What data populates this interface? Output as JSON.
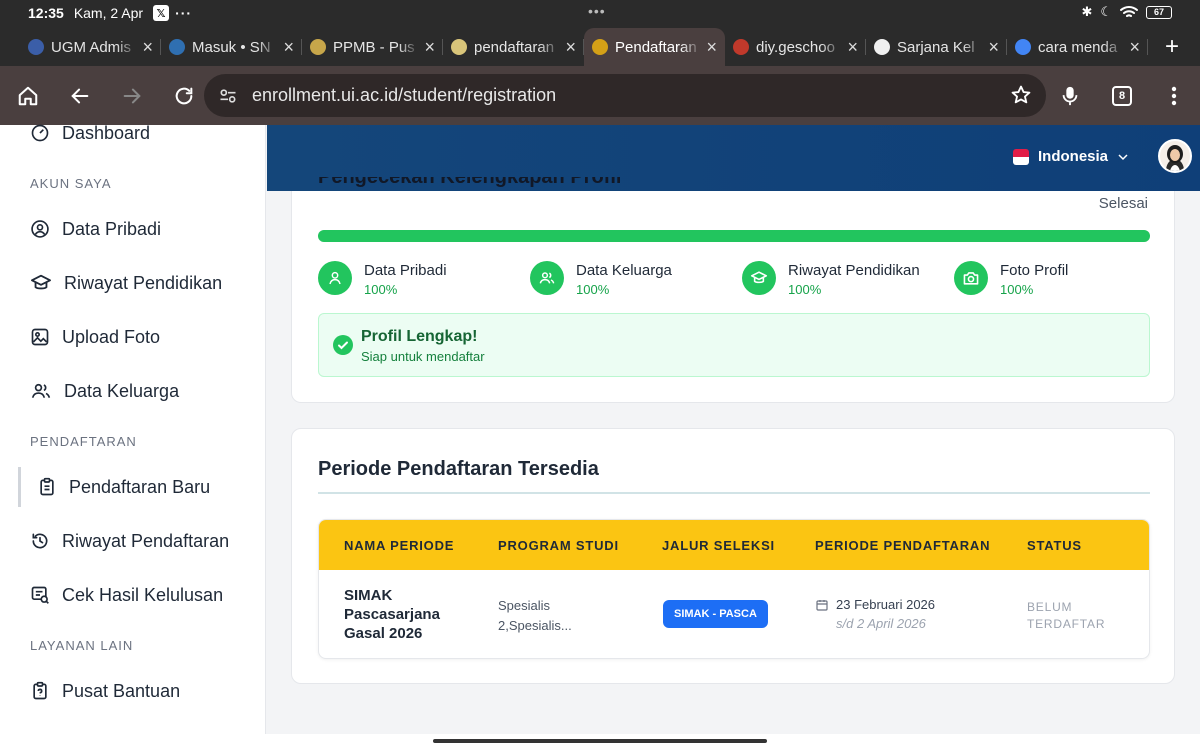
{
  "status_bar": {
    "time": "12:35",
    "date": "Kam, 2 Apr",
    "battery": "67"
  },
  "tabs": [
    {
      "title": "UGM Admis",
      "color": "#3b5ea8"
    },
    {
      "title": "Masuk • SN",
      "color": "#2f6fb1"
    },
    {
      "title": "PPMB - Pus",
      "color": "#c7a64a"
    },
    {
      "title": "pendaftaran",
      "color": "#d9c57a"
    },
    {
      "title": "Pendaftaran",
      "color": "#d4a017",
      "active": true
    },
    {
      "title": "diy.geschoo",
      "color": "#c0392b"
    },
    {
      "title": "Sarjana Kel",
      "color": "#f0f0f0"
    },
    {
      "title": "cara menda",
      "color": "#4285f4"
    }
  ],
  "address_bar": {
    "url": "enrollment.ui.ac.id/student/registration",
    "tab_count": "8"
  },
  "sidebar": {
    "top_item": "Dashboard",
    "section_account": "AKUN SAYA",
    "items_account": [
      "Data Pribadi",
      "Riwayat Pendidikan",
      "Upload Foto",
      "Data Keluarga"
    ],
    "section_registration": "PENDAFTARAN",
    "items_registration": [
      "Pendaftaran Baru",
      "Riwayat Pendaftaran",
      "Cek Hasil Kelulusan"
    ],
    "section_other": "LAYANAN LAIN",
    "items_other": [
      "Pusat Bantuan"
    ]
  },
  "header": {
    "language": "Indonesia"
  },
  "profile_card": {
    "title": "Pengecekan Kelengkapan Profil",
    "status_label": "Selesai",
    "progress_fraction": 1.0,
    "steps": [
      {
        "label": "Data Pribadi",
        "pct": "100%"
      },
      {
        "label": "Data Keluarga",
        "pct": "100%"
      },
      {
        "label": "Riwayat Pendidikan",
        "pct": "100%"
      },
      {
        "label": "Foto Profil",
        "pct": "100%"
      }
    ],
    "complete_title": "Profil Lengkap!",
    "complete_sub": "Siap untuk mendaftar"
  },
  "periods_card": {
    "heading": "Periode Pendaftaran Tersedia",
    "columns": [
      "NAMA PERIODE",
      "PROGRAM STUDI",
      "JALUR SELEKSI",
      "PERIODE PENDAFTARAN",
      "STATUS"
    ],
    "row": {
      "name": "SIMAK Pascasarjana Gasal 2026",
      "program": [
        "Spesialis",
        "2,Spesialis..."
      ],
      "jalur": "SIMAK - PASCA",
      "start": "23 Februari 2026",
      "end": "s/d 2 April 2026",
      "status": [
        "BELUM",
        "TERDAFTAR"
      ]
    }
  },
  "colors": {
    "accent_green": "#22c55e",
    "header_blue": "#14467a",
    "table_head_yellow": "#fbc512",
    "badge_blue": "#1d6ef5"
  }
}
